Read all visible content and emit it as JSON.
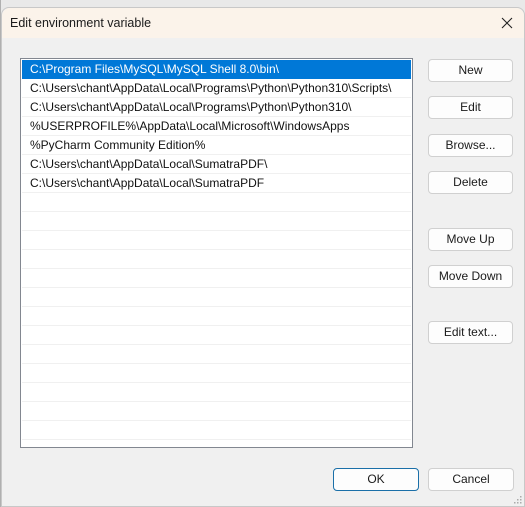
{
  "window": {
    "title": "Edit environment variable",
    "close_icon": "close-icon"
  },
  "list": {
    "items": [
      {
        "value": "C:\\Program Files\\MySQL\\MySQL Shell 8.0\\bin\\",
        "selected": true
      },
      {
        "value": "C:\\Users\\chant\\AppData\\Local\\Programs\\Python\\Python310\\Scripts\\",
        "selected": false
      },
      {
        "value": "C:\\Users\\chant\\AppData\\Local\\Programs\\Python\\Python310\\",
        "selected": false
      },
      {
        "value": "%USERPROFILE%\\AppData\\Local\\Microsoft\\WindowsApps",
        "selected": false
      },
      {
        "value": "%PyCharm Community Edition%",
        "selected": false
      },
      {
        "value": "C:\\Users\\chant\\AppData\\Local\\SumatraPDF\\",
        "selected": false
      },
      {
        "value": "C:\\Users\\chant\\AppData\\Local\\SumatraPDF",
        "selected": false
      }
    ],
    "selection_color": "#0078d7"
  },
  "buttons": {
    "new": "New",
    "edit": "Edit",
    "browse": "Browse...",
    "delete": "Delete",
    "move_up": "Move Up",
    "move_down": "Move Down",
    "edit_text": "Edit text...",
    "ok": "OK",
    "cancel": "Cancel"
  }
}
